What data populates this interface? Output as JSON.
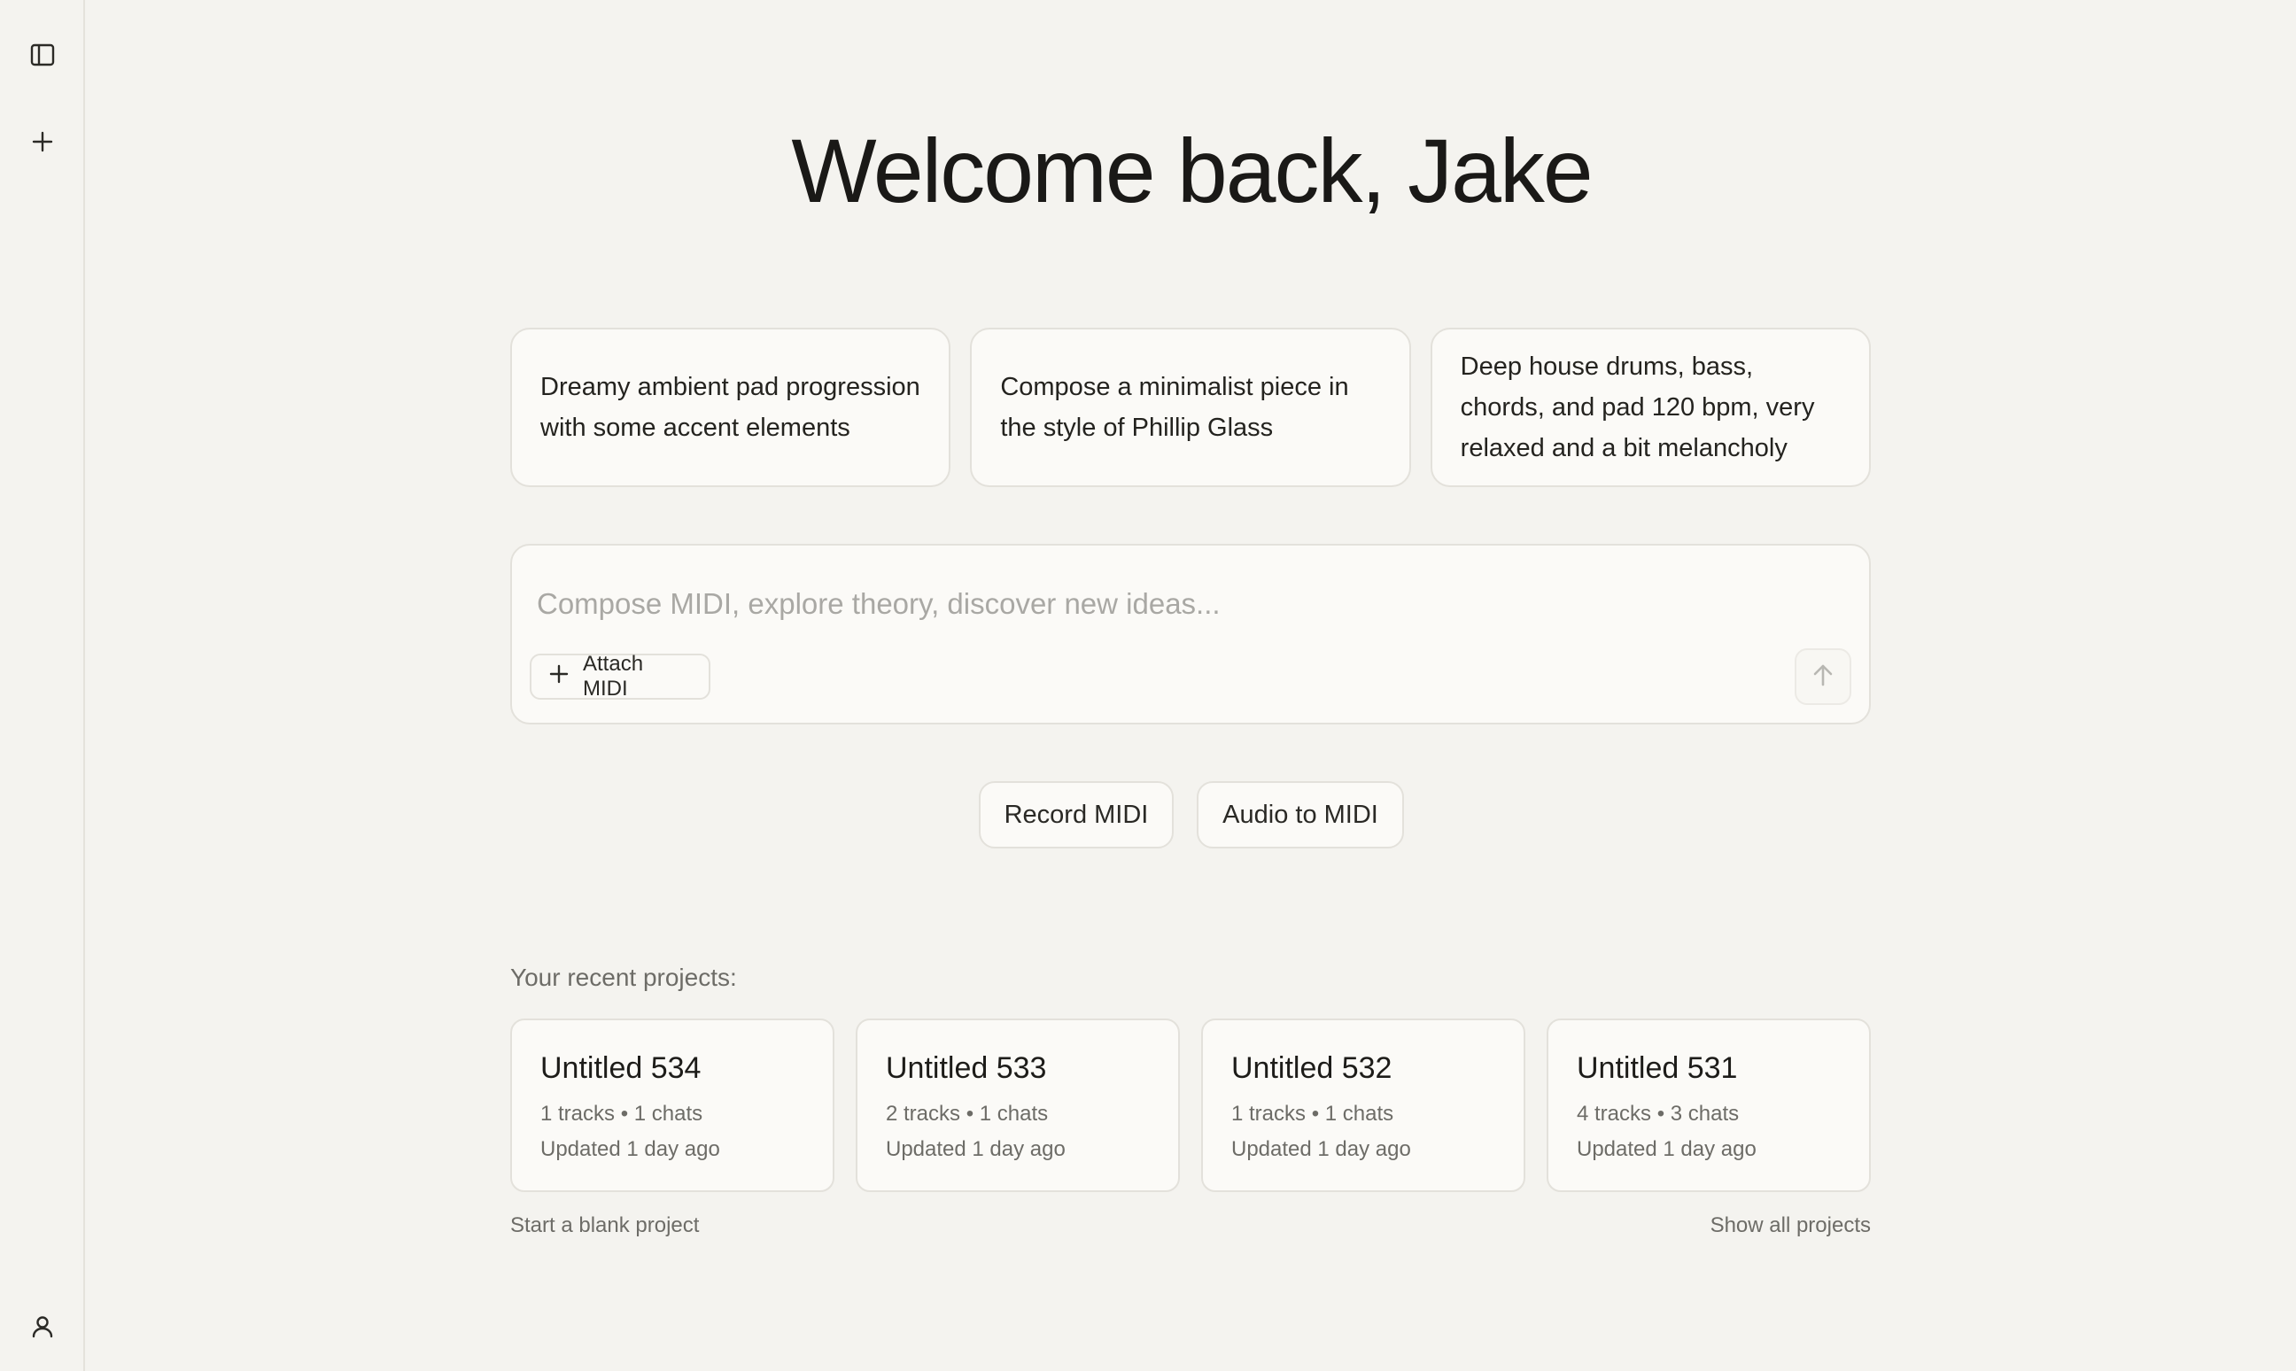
{
  "sidebar": {
    "toggle_icon": "sidebar-toggle-icon",
    "new_icon": "plus-icon",
    "user_icon": "user-icon"
  },
  "welcome": {
    "title": "Welcome back, Jake"
  },
  "suggestions": [
    {
      "text": "Dreamy ambient pad progression with some accent elements"
    },
    {
      "text": "Compose a minimalist piece in the style of Phillip Glass"
    },
    {
      "text": "Deep house drums, bass, chords, and pad 120 bpm, very relaxed and a bit melancholy"
    }
  ],
  "composer": {
    "placeholder": "Compose MIDI, explore theory, discover new ideas...",
    "value": "",
    "attach_label": "Attach MIDI",
    "send_icon": "arrow-up-icon"
  },
  "actions": {
    "record_label": "Record MIDI",
    "audio_label": "Audio to MIDI"
  },
  "recent": {
    "label": "Your recent projects:",
    "projects": [
      {
        "name": "Untitled 534",
        "meta": "1 tracks • 1 chats",
        "updated": "Updated 1 day ago"
      },
      {
        "name": "Untitled 533",
        "meta": "2 tracks • 1 chats",
        "updated": "Updated 1 day ago"
      },
      {
        "name": "Untitled 532",
        "meta": "1 tracks • 1 chats",
        "updated": "Updated 1 day ago"
      },
      {
        "name": "Untitled 531",
        "meta": "4 tracks • 3 chats",
        "updated": "Updated 1 day ago"
      }
    ],
    "blank_label": "Start a blank project",
    "show_all_label": "Show all projects"
  },
  "colors": {
    "background": "#f4f3ef",
    "card": "#fbfaf7",
    "border": "#e3e1db",
    "text": "#1c1b19",
    "muted": "#6d6c67"
  }
}
